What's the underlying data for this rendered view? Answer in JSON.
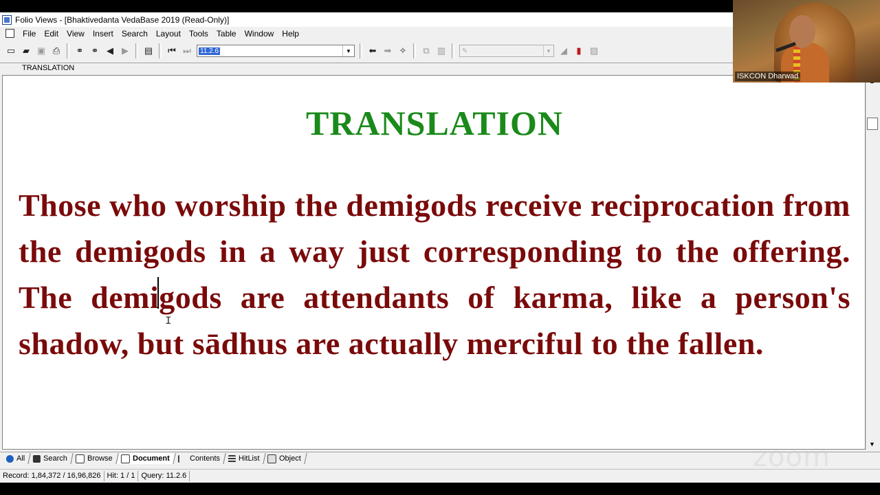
{
  "window": {
    "title": "Folio Views - [Bhaktivedanta VedaBase 2019  (Read-Only)]"
  },
  "menu": [
    "File",
    "Edit",
    "View",
    "Insert",
    "Search",
    "Layout",
    "Tools",
    "Table",
    "Window",
    "Help"
  ],
  "toolbar": {
    "query_combo_value": "11.2.6"
  },
  "section_label": "TRANSLATION",
  "document": {
    "heading": "TRANSLATION",
    "body": "Those who worship the demigods receive reciprocation from the demigods in a way just corresponding to the offering. The demigods are attendants of karma, like a person's shadow, but sādhus are actually merciful to the fallen."
  },
  "tabs": [
    {
      "label": "All",
      "icon": "globe-icon",
      "active": false
    },
    {
      "label": "Search",
      "icon": "binoculars-icon",
      "active": false
    },
    {
      "label": "Browse",
      "icon": "book-icon",
      "active": false
    },
    {
      "label": "Document",
      "icon": "document-icon",
      "active": true
    },
    {
      "label": "Contents",
      "icon": "contents-tree-icon",
      "active": false
    },
    {
      "label": "HitList",
      "icon": "list-icon",
      "active": false
    },
    {
      "label": "Object",
      "icon": "object-icon",
      "active": false
    }
  ],
  "status": {
    "record": "Record: 1,84,372 / 16,96,826",
    "hit": "Hit: 1 / 1",
    "query": "Query: 11.2.6"
  },
  "video": {
    "participant_name": "ISKCON Dharwad"
  },
  "watermark": "zoom",
  "colors": {
    "heading": "#1a8a1a",
    "body": "#7a0a0a",
    "selection": "#2f67d6"
  }
}
